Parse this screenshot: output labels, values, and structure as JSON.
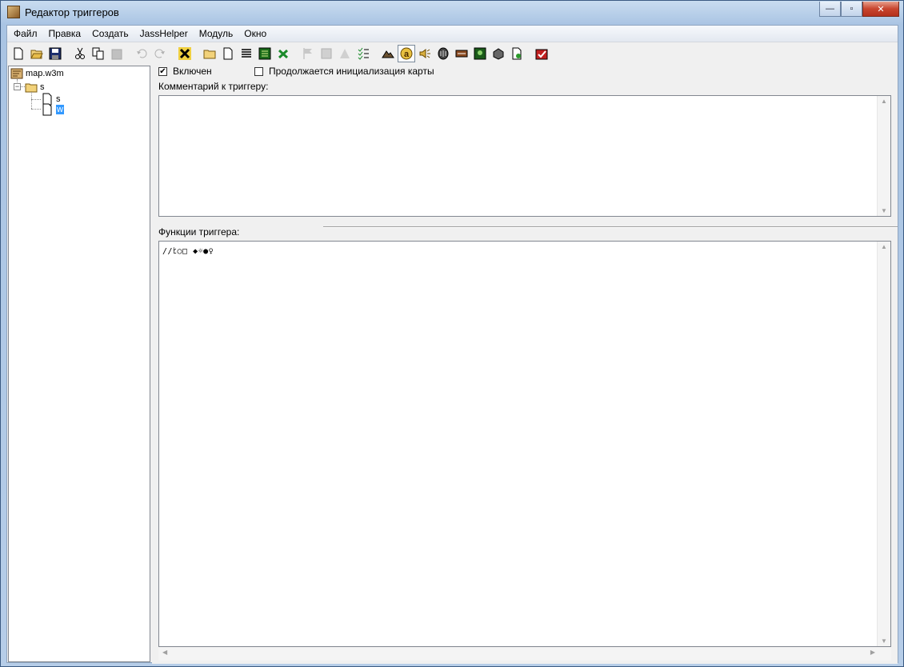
{
  "window": {
    "title": "Редактор триггеров",
    "controls": {
      "minimize": "—",
      "maximize": "▫",
      "close": "✕"
    }
  },
  "menu": [
    "Файл",
    "Правка",
    "Создать",
    "JassHelper",
    "Модуль",
    "Окно"
  ],
  "toolbar": {
    "icons": [
      "new-icon",
      "open-icon",
      "save-icon",
      "cut-icon",
      "copy-icon",
      "paste-icon",
      "undo-icon",
      "redo-icon",
      "delete-icon",
      "new-category-icon",
      "new-trigger-icon",
      "new-comment-icon",
      "variables-icon",
      "disable-icon",
      "flag-icon",
      "event-icon",
      "condition-icon",
      "action-icon",
      "terrain-editor-icon",
      "trigger-editor-icon",
      "sound-editor-icon",
      "object-editor-icon",
      "campaign-editor-icon",
      "ai-editor-icon",
      "object-manager-icon",
      "import-manager-icon",
      "test-map-icon"
    ]
  },
  "tree": {
    "root": "map.w3m",
    "category": "s",
    "triggers": [
      "s",
      "w"
    ],
    "selected": "w"
  },
  "trigger": {
    "enabled_label": "Включен",
    "enabled": true,
    "init_label": "Продолжается инициализация карты",
    "init": false,
    "comment_label": "Комментарий к триггеру:",
    "comment_text": "",
    "functions_label": "Функции триггера:",
    "code": "//ﾋ○□ ◆☼●♀"
  },
  "colors": {
    "selection": "#3399ff",
    "close_button": "#c8452e"
  }
}
